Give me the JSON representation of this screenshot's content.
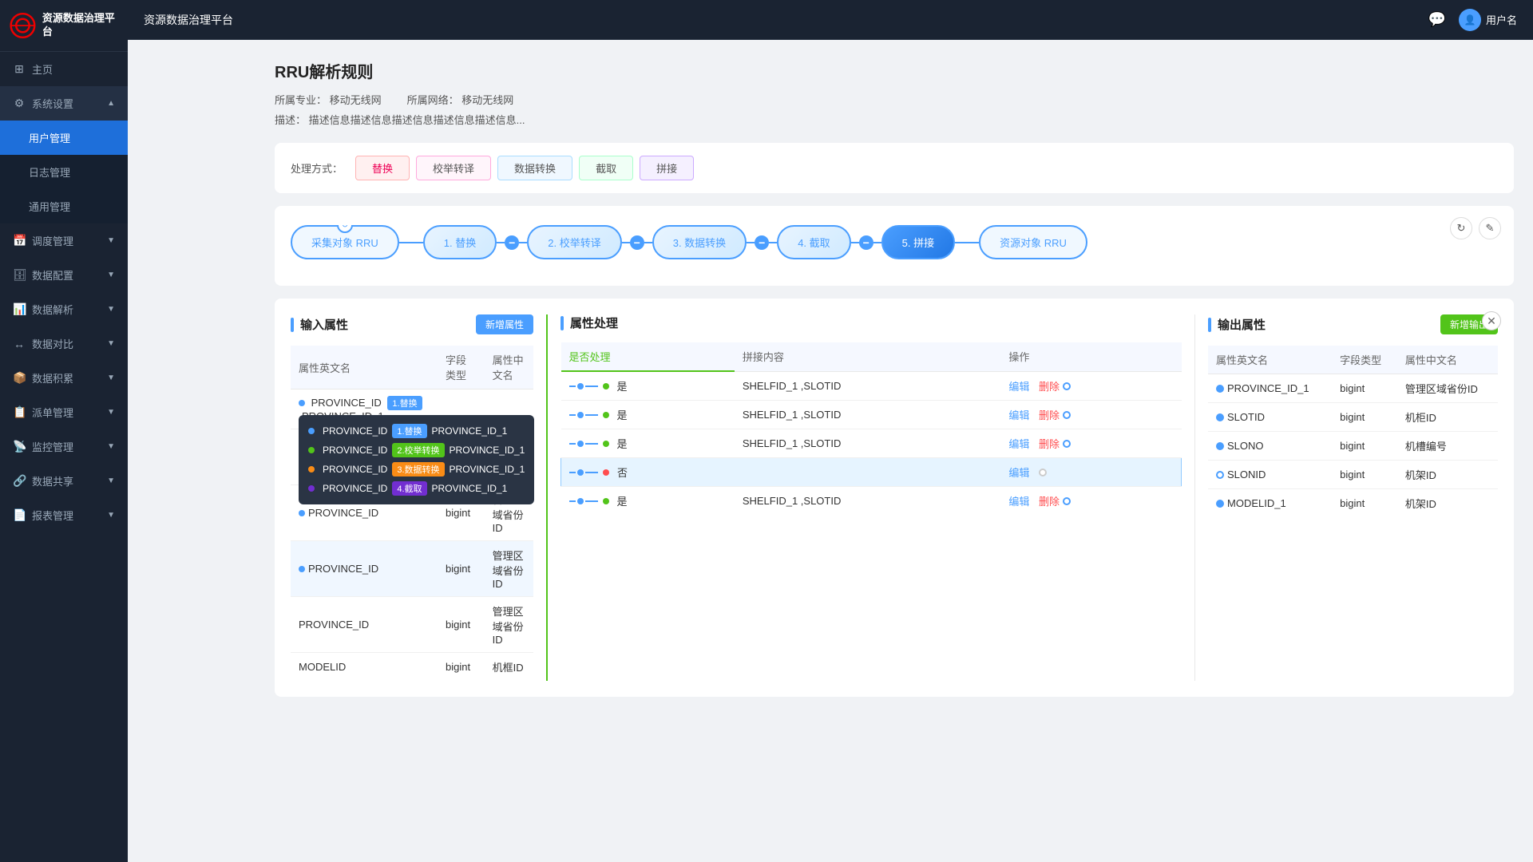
{
  "app": {
    "logo_text": "资源数据治理平台",
    "header_icon": "🔔",
    "user_label": "用户名"
  },
  "sidebar": {
    "items": [
      {
        "id": "home",
        "label": "主页",
        "icon": "⊞",
        "active": false
      },
      {
        "id": "system",
        "label": "系统设置",
        "icon": "⚙",
        "active": true,
        "expanded": true
      },
      {
        "id": "user-mgmt",
        "label": "用户管理",
        "icon": "",
        "active": true,
        "submenu": true
      },
      {
        "id": "log-mgmt",
        "label": "日志管理",
        "icon": "",
        "active": false,
        "submenu": true
      },
      {
        "id": "general-mgmt",
        "label": "通用管理",
        "icon": "",
        "active": false,
        "submenu": true
      },
      {
        "id": "schedule",
        "label": "调度管理",
        "icon": "📅",
        "active": false,
        "expanded": false
      },
      {
        "id": "data-config",
        "label": "数据配置",
        "icon": "🗄",
        "active": false,
        "expanded": false
      },
      {
        "id": "data-analysis",
        "label": "数据解析",
        "icon": "📊",
        "active": false,
        "expanded": false
      },
      {
        "id": "data-compare",
        "label": "数据对比",
        "icon": "↔",
        "active": false,
        "expanded": false
      },
      {
        "id": "data-accum",
        "label": "数据积累",
        "icon": "📦",
        "active": false,
        "expanded": false
      },
      {
        "id": "order-mgmt",
        "label": "派单管理",
        "icon": "📋",
        "active": false,
        "expanded": false
      },
      {
        "id": "monitor",
        "label": "监控管理",
        "icon": "📡",
        "active": false,
        "expanded": false
      },
      {
        "id": "data-share",
        "label": "数据共享",
        "icon": "🔗",
        "active": false,
        "expanded": false
      },
      {
        "id": "report",
        "label": "报表管理",
        "icon": "📄",
        "active": false,
        "expanded": false
      }
    ]
  },
  "page": {
    "title": "RRU解析规则",
    "meta": {
      "domain_label": "所属专业：",
      "domain_value": "移动无线网",
      "network_label": "所属网络：",
      "network_value": "移动无线网"
    },
    "desc_label": "描述：",
    "desc_value": "描述信息描述信息描述信息描述信息描述信息..."
  },
  "process": {
    "label": "处理方式：",
    "modes": [
      {
        "id": "replace",
        "label": "替换",
        "active": true
      },
      {
        "id": "enum",
        "label": "校举转译",
        "active": false
      },
      {
        "id": "transform",
        "label": "数据转换",
        "active": false
      },
      {
        "id": "extract",
        "label": "截取",
        "active": false
      },
      {
        "id": "concat",
        "label": "拼接",
        "active": false
      }
    ]
  },
  "pipeline": {
    "source": "采集对象 RRU",
    "target": "资源对象 RRU",
    "steps": [
      {
        "id": 1,
        "label": "1. 替换"
      },
      {
        "id": 2,
        "label": "2. 校举转译"
      },
      {
        "id": 3,
        "label": "3. 数据转换"
      },
      {
        "id": 4,
        "label": "4. 截取"
      },
      {
        "id": 5,
        "label": "5. 拼接",
        "active": true
      }
    ]
  },
  "input_attrs": {
    "title": "输入属性",
    "add_btn": "新增属性",
    "columns": [
      "属性英文名",
      "字段类型",
      "属性中文名"
    ],
    "rows": [
      {
        "name": "PROVINCE_ID",
        "type": "bigint",
        "cn_name": "管理区域省份ID",
        "tag": "1.替换",
        "tag_color": "blue"
      },
      {
        "name": "PROVINCE_ID",
        "type": "bigint",
        "cn_name": "管理区域省份ID",
        "tag": "2.校举转换",
        "tag_color": "green"
      },
      {
        "name": "PROVINCE_ID",
        "type": "bigint",
        "cn_name": "管理区域省份ID",
        "tag": "3.数据转换",
        "tag_color": "orange"
      },
      {
        "name": "PROVINCE_ID",
        "type": "bigint",
        "cn_name": "管理区域省份ID",
        "tag": "4.截取",
        "tag_color": "purple"
      },
      {
        "name": "PROVINCE_ID",
        "type": "bigint",
        "cn_name": "管理区域省份ID"
      },
      {
        "name": "MODELID",
        "type": "bigint",
        "cn_name": "机框ID"
      }
    ]
  },
  "attr_process": {
    "title": "属性处理",
    "columns": [
      "是否处理",
      "拼接内容",
      "操作"
    ],
    "rows": [
      {
        "processed": true,
        "concat": "SHELFID_1 ,SLOTID",
        "ops": [
          "编辑",
          "删除"
        ]
      },
      {
        "processed": true,
        "concat": "SHELFID_1 ,SLOTID",
        "ops": [
          "编辑",
          "删除"
        ]
      },
      {
        "processed": true,
        "concat": "SHELFID_1 ,SLOTID",
        "ops": [
          "编辑",
          "删除"
        ]
      },
      {
        "processed": false,
        "concat": "",
        "ops": [
          "编辑"
        ]
      },
      {
        "processed": true,
        "concat": "SHELFID_1 ,SLOTID",
        "ops": [
          "编辑",
          "删除"
        ]
      }
    ]
  },
  "output_attrs": {
    "title": "输出属性",
    "add_btn": "新增输出",
    "columns": [
      "属性英文名",
      "字段类型",
      "属性中文名"
    ],
    "rows": [
      {
        "name": "PROVINCE_ID_1",
        "type": "bigint",
        "cn_name": "管理区域省份ID"
      },
      {
        "name": "SLOTID",
        "type": "bigint",
        "cn_name": "机柜ID"
      },
      {
        "name": "SLONO",
        "type": "bigint",
        "cn_name": "机槽编号"
      },
      {
        "name": "SLONID",
        "type": "bigint",
        "cn_name": "机架ID"
      },
      {
        "name": "MODELID_1",
        "type": "bigint",
        "cn_name": "机架ID"
      }
    ]
  },
  "tooltip": {
    "rows": [
      {
        "label": "PROVINCE_ID",
        "tag": "1.替换",
        "value": "PROVINCE_ID_1",
        "color": "blue"
      },
      {
        "label": "PROVINCE_ID",
        "tag": "2.校举转换",
        "value": "PROVINCE_ID_1",
        "color": "green"
      },
      {
        "label": "PROVINCE_ID",
        "tag": "3.数据转换",
        "value": "PROVINCE_ID_1",
        "color": "orange"
      },
      {
        "label": "PROVINCE_ID",
        "tag": "4.截取",
        "value": "PROVINCE_ID_1",
        "color": "purple"
      }
    ]
  }
}
